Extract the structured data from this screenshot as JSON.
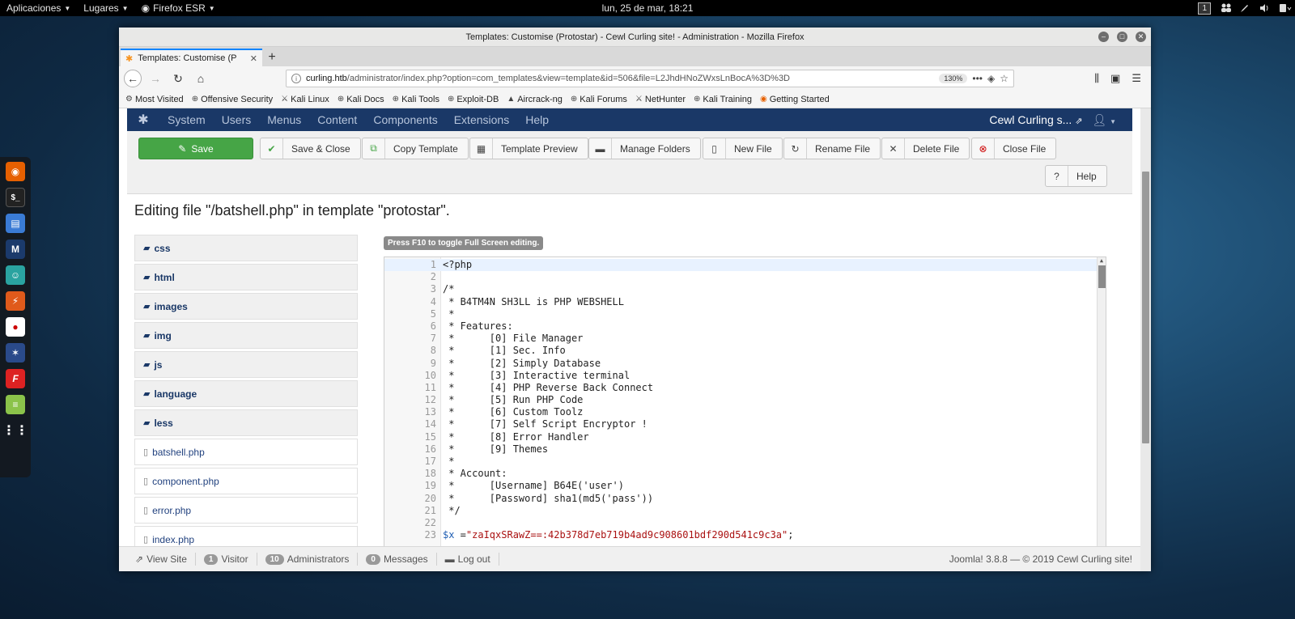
{
  "topbar": {
    "applications": "Aplicaciones",
    "places": "Lugares",
    "browser": "Firefox ESR",
    "clock": "lun, 25 de mar, 18:21",
    "workspace": "1"
  },
  "window": {
    "title": "Templates: Customise (Protostar) - Cewl Curling site! - Administration - Mozilla Firefox",
    "tab_label": "Templates: Customise (P",
    "url_host": "curling.htb",
    "url_path": "/administrator/index.php?option=com_templates&view=template&id=506&file=L2JhdHNoZWxsLnBocA%3D%3D",
    "zoom": "130%"
  },
  "bookmarks": [
    "Most Visited",
    "Offensive Security",
    "Kali Linux",
    "Kali Docs",
    "Kali Tools",
    "Exploit-DB",
    "Aircrack-ng",
    "Kali Forums",
    "NetHunter",
    "Kali Training",
    "Getting Started"
  ],
  "joomla": {
    "menu": [
      "System",
      "Users",
      "Menus",
      "Content",
      "Components",
      "Extensions",
      "Help"
    ],
    "site_name": "Cewl Curling s...",
    "toolbar": {
      "save": "Save",
      "save_close": "Save & Close",
      "copy_template": "Copy Template",
      "template_preview": "Template Preview",
      "manage_folders": "Manage Folders",
      "new_file": "New File",
      "rename_file": "Rename File",
      "delete_file": "Delete File",
      "close_file": "Close File",
      "help": "Help"
    },
    "heading": "Editing file \"/batshell.php\" in template \"protostar\".",
    "folders": [
      "css",
      "html",
      "images",
      "img",
      "js",
      "language",
      "less"
    ],
    "files": [
      "batshell.php",
      "component.php",
      "error.php",
      "index.php"
    ],
    "editor_hint": "Press F10 to toggle Full Screen editing.",
    "code_lines": [
      "<?php",
      "",
      "/*",
      " * B4TM4N SH3LL is PHP WEBSHELL",
      " *",
      " * Features:",
      " *      [0] File Manager",
      " *      [1] Sec. Info",
      " *      [2] Simply Database",
      " *      [3] Interactive terminal",
      " *      [4] PHP Reverse Back Connect",
      " *      [5] Run PHP Code",
      " *      [6] Custom Toolz",
      " *      [7] Self Script Encryptor !",
      " *      [8] Error Handler",
      " *      [9] Themes",
      " *",
      " * Account:",
      " *      [Username] B64E('user')",
      " *      [Password] sha1(md5('pass'))",
      " */",
      "",
      "$x =\"zaIqxSRawZ==:42b378d7eb719b4ad9c908601bdf290d541c9c3a\";"
    ],
    "status": {
      "view_site": "View Site",
      "visitor_count": "1",
      "visitor_label": "Visitor",
      "admin_count": "10",
      "admin_label": "Administrators",
      "messages_count": "0",
      "messages_label": "Messages",
      "logout": "Log out",
      "version": "Joomla! 3.8.8  —  © 2019 Cewl Curling site!"
    }
  }
}
